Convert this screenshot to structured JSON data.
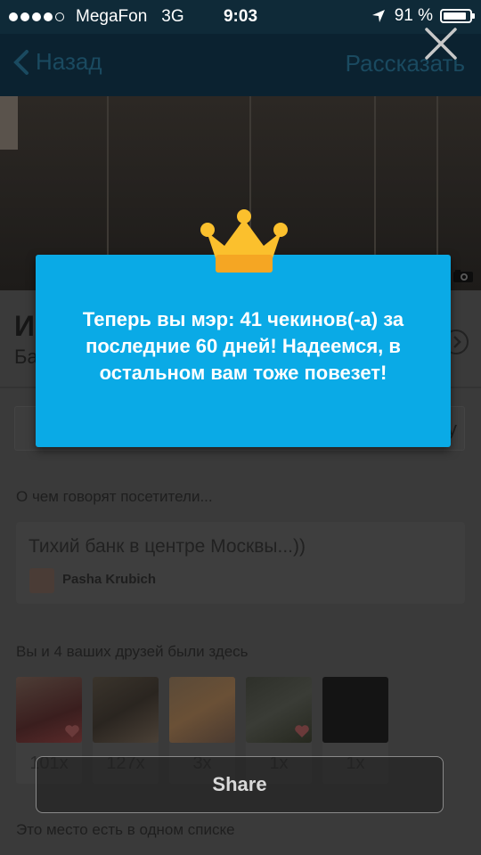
{
  "status_bar": {
    "carrier": "MegaFon",
    "network": "3G",
    "time": "9:03",
    "battery": "91 %",
    "battery_level": 0.91
  },
  "nav": {
    "back_label": "Назад",
    "share_label": "Рассказать"
  },
  "venue": {
    "title": "И",
    "subtitle": "Ба",
    "tip_button_tail": "ку"
  },
  "tips_section": {
    "heading": "О чем говорят посетители...",
    "tip_text": "Тихий банк в центре Москвы...))",
    "tip_author": "Pasha Krubich"
  },
  "friends_section": {
    "heading": "Вы и 4 ваших друзей были здесь",
    "friends": [
      {
        "count": "101x",
        "liked": true
      },
      {
        "count": "127x",
        "liked": false
      },
      {
        "count": "3x",
        "liked": false
      },
      {
        "count": "1x",
        "liked": true
      },
      {
        "count": "1x",
        "liked": false
      }
    ]
  },
  "lists_section": {
    "heading": "Это место есть в одном списке"
  },
  "mayor_modal": {
    "message": "Теперь вы мэр: 41 чекинов(-а) за последние 60 дней! Надеемся, в остальном вам тоже повезет!",
    "share_label": "Share",
    "accent_color": "#0aaae6",
    "crown_color": "#fbc02d"
  }
}
